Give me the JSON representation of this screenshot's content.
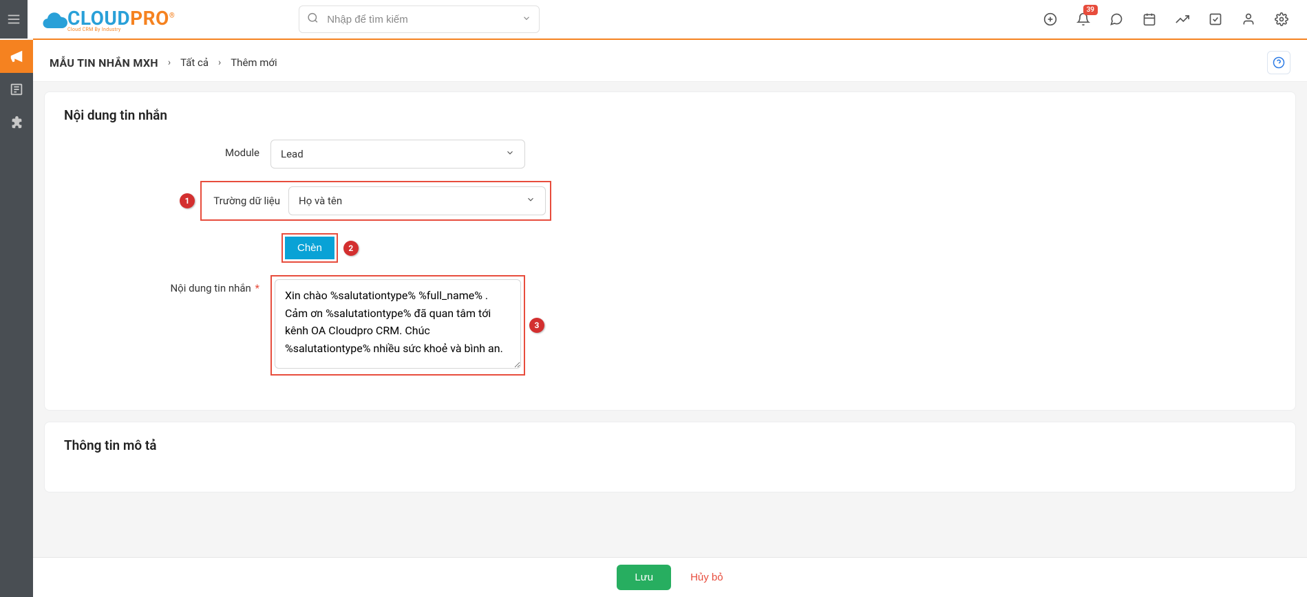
{
  "header": {
    "search_placeholder": "Nhập để tìm kiếm",
    "notification_count": "39",
    "logo_text_1": "CLOUD",
    "logo_text_2": "PRO",
    "logo_sub": "Cloud CRM By Industry"
  },
  "breadcrumb": {
    "title": "MẪU TIN NHẮN MXH",
    "item1": "Tất cả",
    "item2": "Thêm mới"
  },
  "section1": {
    "title": "Nội dung tin nhắn",
    "module_label": "Module",
    "module_value": "Lead",
    "field_label": "Trường dữ liệu",
    "field_value": "Họ và tên",
    "insert_label": "Chèn",
    "content_label": "Nội dung tin nhắn",
    "content_value": "Xin chào %salutationtype% %full_name% . Cảm ơn %salutationtype% đã quan tâm tới kênh OA Cloudpro CRM. Chúc %salutationtype% nhiều sức khoẻ và bình an."
  },
  "section2": {
    "title": "Thông tin mô tả"
  },
  "footer": {
    "save": "Lưu",
    "cancel": "Hủy bỏ"
  },
  "annotations": {
    "a1": "1",
    "a2": "2",
    "a3": "3"
  }
}
